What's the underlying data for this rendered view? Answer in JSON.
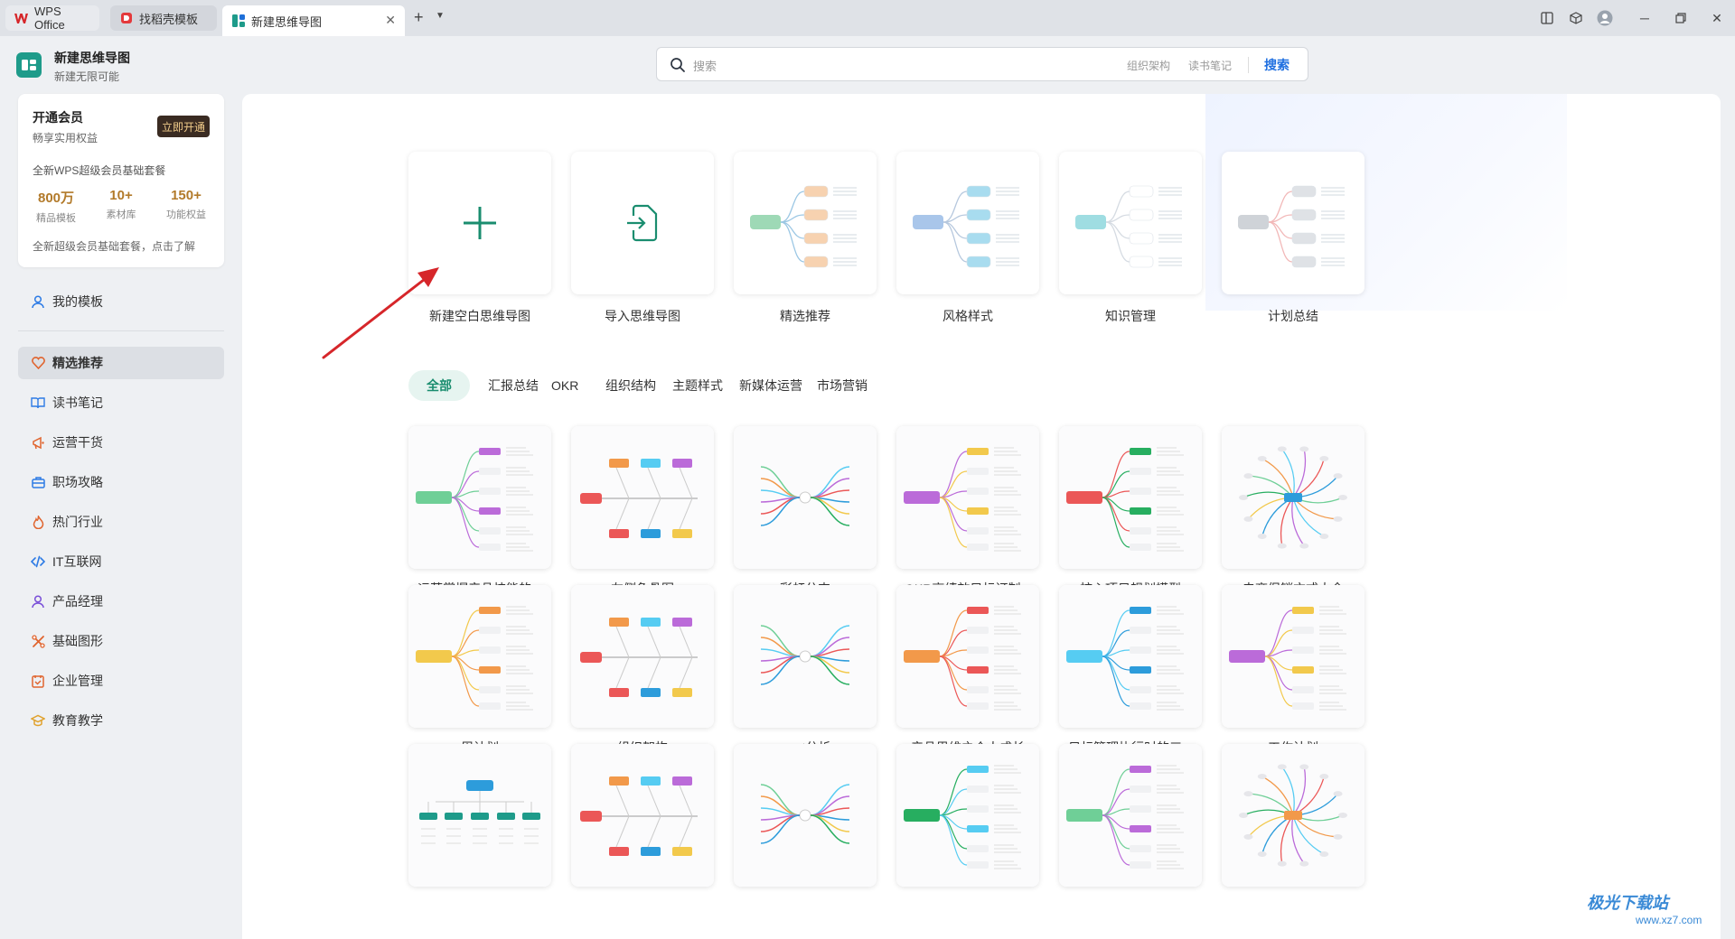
{
  "tabs": [
    {
      "label": "WPS Office",
      "icon": "wps-logo-icon"
    },
    {
      "label": "找稻壳模板",
      "icon": "docer-icon"
    },
    {
      "label": "新建思维导图",
      "icon": "mindmap-icon",
      "active": true
    }
  ],
  "app": {
    "title": "新建思维导图",
    "subtitle": "新建无限可能"
  },
  "search": {
    "placeholder": "搜索",
    "tags": [
      "组织架构",
      "读书笔记"
    ],
    "button": "搜索"
  },
  "vip": {
    "title": "开通会员",
    "subtitle": "畅享实用权益",
    "button": "立即开通",
    "desc": "全新WPS超级会员基础套餐",
    "stats": [
      {
        "num": "800万",
        "label": "精品模板"
      },
      {
        "num": "10+",
        "label": "素材库"
      },
      {
        "num": "150+",
        "label": "功能权益"
      }
    ],
    "footer": "全新超级会员基础套餐，点击了解"
  },
  "nav": {
    "my_templates": "我的模板",
    "items": [
      {
        "label": "精选推荐",
        "icon": "heart-icon",
        "color": "#e0642e",
        "active": true
      },
      {
        "label": "读书笔记",
        "icon": "book-icon",
        "color": "#2d7be5"
      },
      {
        "label": "运营干货",
        "icon": "megaphone-icon",
        "color": "#e0642e"
      },
      {
        "label": "职场攻略",
        "icon": "briefcase-icon",
        "color": "#2d7be5"
      },
      {
        "label": "热门行业",
        "icon": "flame-icon",
        "color": "#e0642e"
      },
      {
        "label": "IT互联网",
        "icon": "code-icon",
        "color": "#2d7be5"
      },
      {
        "label": "产品经理",
        "icon": "person-icon",
        "color": "#7a4fd8"
      },
      {
        "label": "基础图形",
        "icon": "shapes-icon",
        "color": "#e0642e"
      },
      {
        "label": "企业管理",
        "icon": "calendar-icon",
        "color": "#e0642e"
      },
      {
        "label": "教育教学",
        "icon": "graduation-icon",
        "color": "#e0a22e"
      }
    ]
  },
  "features": [
    {
      "label": "新建空白思维导图",
      "icon": "plus-icon"
    },
    {
      "label": "导入思维导图",
      "icon": "import-icon"
    },
    {
      "label": "精选推荐",
      "icon": "mindmap-preview-green"
    },
    {
      "label": "风格样式",
      "icon": "mindmap-preview-blue"
    },
    {
      "label": "知识管理",
      "icon": "mindmap-preview-cyan"
    },
    {
      "label": "计划总结",
      "icon": "mindmap-preview-gray"
    }
  ],
  "categories": [
    "全部",
    "汇报总结",
    "OKR",
    "组织结构",
    "主题样式",
    "新媒体运营",
    "市场营销"
  ],
  "templates": [
    {
      "label": "运营掌握产品技能的..."
    },
    {
      "label": "左侧鱼骨图"
    },
    {
      "label": "彩虹分支"
    },
    {
      "label": "OKR高绩效目标订制..."
    },
    {
      "label": "核心项目规划模型"
    },
    {
      "label": "电商促销方式大全"
    },
    {
      "label": "周计划"
    },
    {
      "label": "组织架构"
    },
    {
      "label": "swot分析"
    },
    {
      "label": "产品思维之个人成长"
    },
    {
      "label": "目标管理执行时的三..."
    },
    {
      "label": "工作计划"
    },
    {
      "label": ""
    },
    {
      "label": ""
    },
    {
      "label": ""
    },
    {
      "label": ""
    },
    {
      "label": ""
    },
    {
      "label": ""
    }
  ],
  "watermark": {
    "text": "极光下载站",
    "url": "www.xz7.com"
  },
  "colors": {
    "accent": "#1a8d6f",
    "search_blue": "#1f6fe0",
    "arrow": "#d6262a"
  }
}
